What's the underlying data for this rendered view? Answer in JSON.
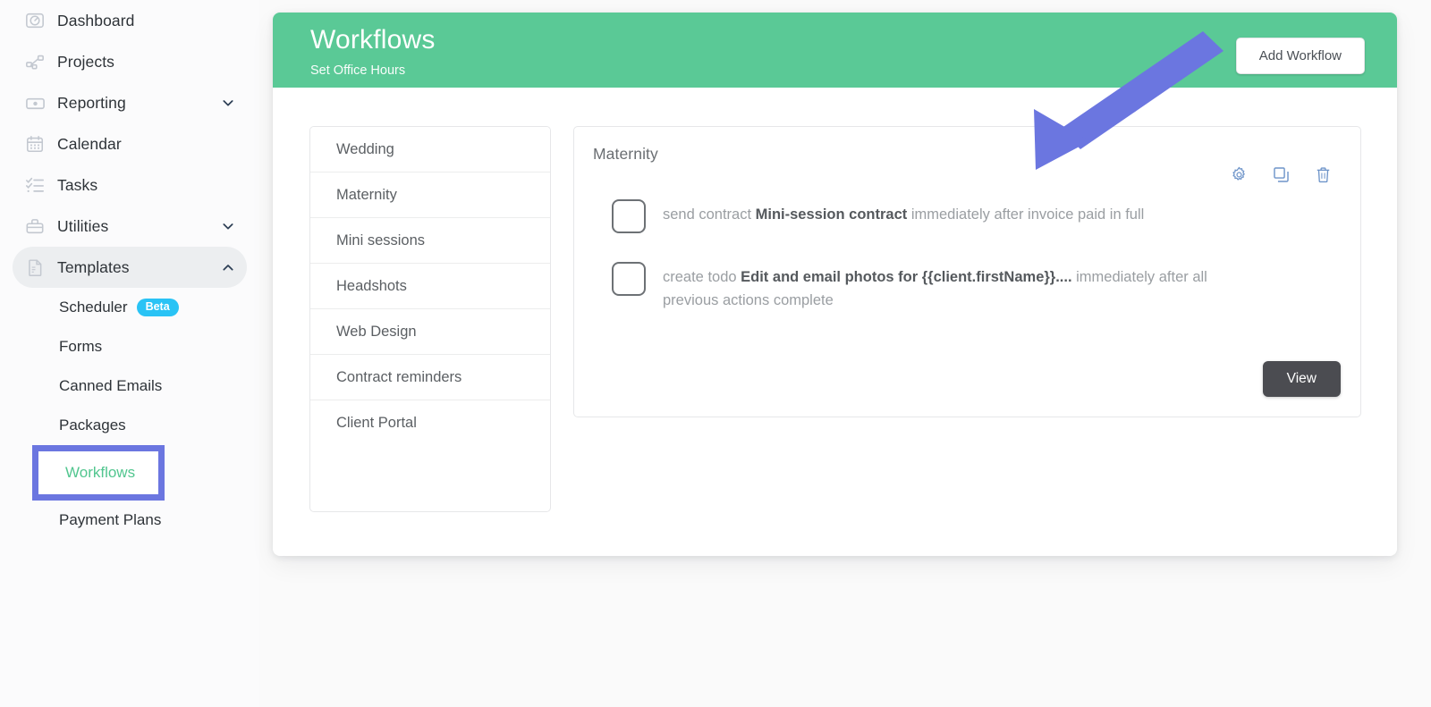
{
  "sidebar": {
    "items": [
      {
        "label": "Dashboard",
        "icon": "dashboard-gauge-icon",
        "expandable": false
      },
      {
        "label": "Projects",
        "icon": "sitemap-icon",
        "expandable": false
      },
      {
        "label": "Reporting",
        "icon": "money-bill-icon",
        "expandable": true,
        "chevron": "chevron-down-icon"
      },
      {
        "label": "Calendar",
        "icon": "calendar-icon",
        "expandable": false
      },
      {
        "label": "Tasks",
        "icon": "checklist-icon",
        "expandable": false
      },
      {
        "label": "Utilities",
        "icon": "toolbox-icon",
        "expandable": true,
        "chevron": "chevron-down-icon"
      },
      {
        "label": "Templates",
        "icon": "document-icon",
        "expandable": true,
        "chevron": "chevron-up-icon",
        "active": true
      }
    ],
    "templates_children": [
      {
        "label": "Scheduler",
        "badge": "Beta"
      },
      {
        "label": "Forms"
      },
      {
        "label": "Canned Emails"
      },
      {
        "label": "Packages"
      },
      {
        "label": "Workflows",
        "selected": true
      },
      {
        "label": "Payment Plans"
      }
    ]
  },
  "header": {
    "title": "Workflows",
    "subtitle": "Set Office Hours",
    "add_button_label": "Add Workflow",
    "background_color": "#5ac996"
  },
  "workflow_list": {
    "items": [
      "Wedding",
      "Maternity",
      "Mini sessions",
      "Headshots",
      "Web Design",
      "Contract reminders",
      "Client Portal"
    ],
    "selected": "Maternity"
  },
  "workflow_detail": {
    "title": "Maternity",
    "actions_icons": [
      {
        "name": "gear-icon",
        "color": "#6e94c9"
      },
      {
        "name": "duplicate-icon",
        "color": "#6e94c9"
      },
      {
        "name": "trash-icon",
        "color": "#6e94c9"
      }
    ],
    "steps": [
      {
        "checked": false,
        "prefix": "send contract ",
        "emphasis": "Mini-session contract",
        "suffix": " immediately after invoice paid in full"
      },
      {
        "checked": false,
        "prefix": " create todo ",
        "emphasis": "Edit and email photos for {{client.firstName}}....",
        "suffix": " immediately after all previous actions complete"
      }
    ],
    "view_button_label": "View"
  },
  "annotations": {
    "arrow_color": "#6b76e0",
    "highlight_box_color": "#6b76e0",
    "highlight_target": "Workflows",
    "arrow_points_to": "Add Workflow"
  },
  "colors": {
    "accent_green": "#5ac996",
    "link_green": "#52c68f",
    "beta_badge": "#29c3f5",
    "annotation_purple": "#6b76e0",
    "view_button": "#4b4c51",
    "page_background": "#fafafa"
  }
}
